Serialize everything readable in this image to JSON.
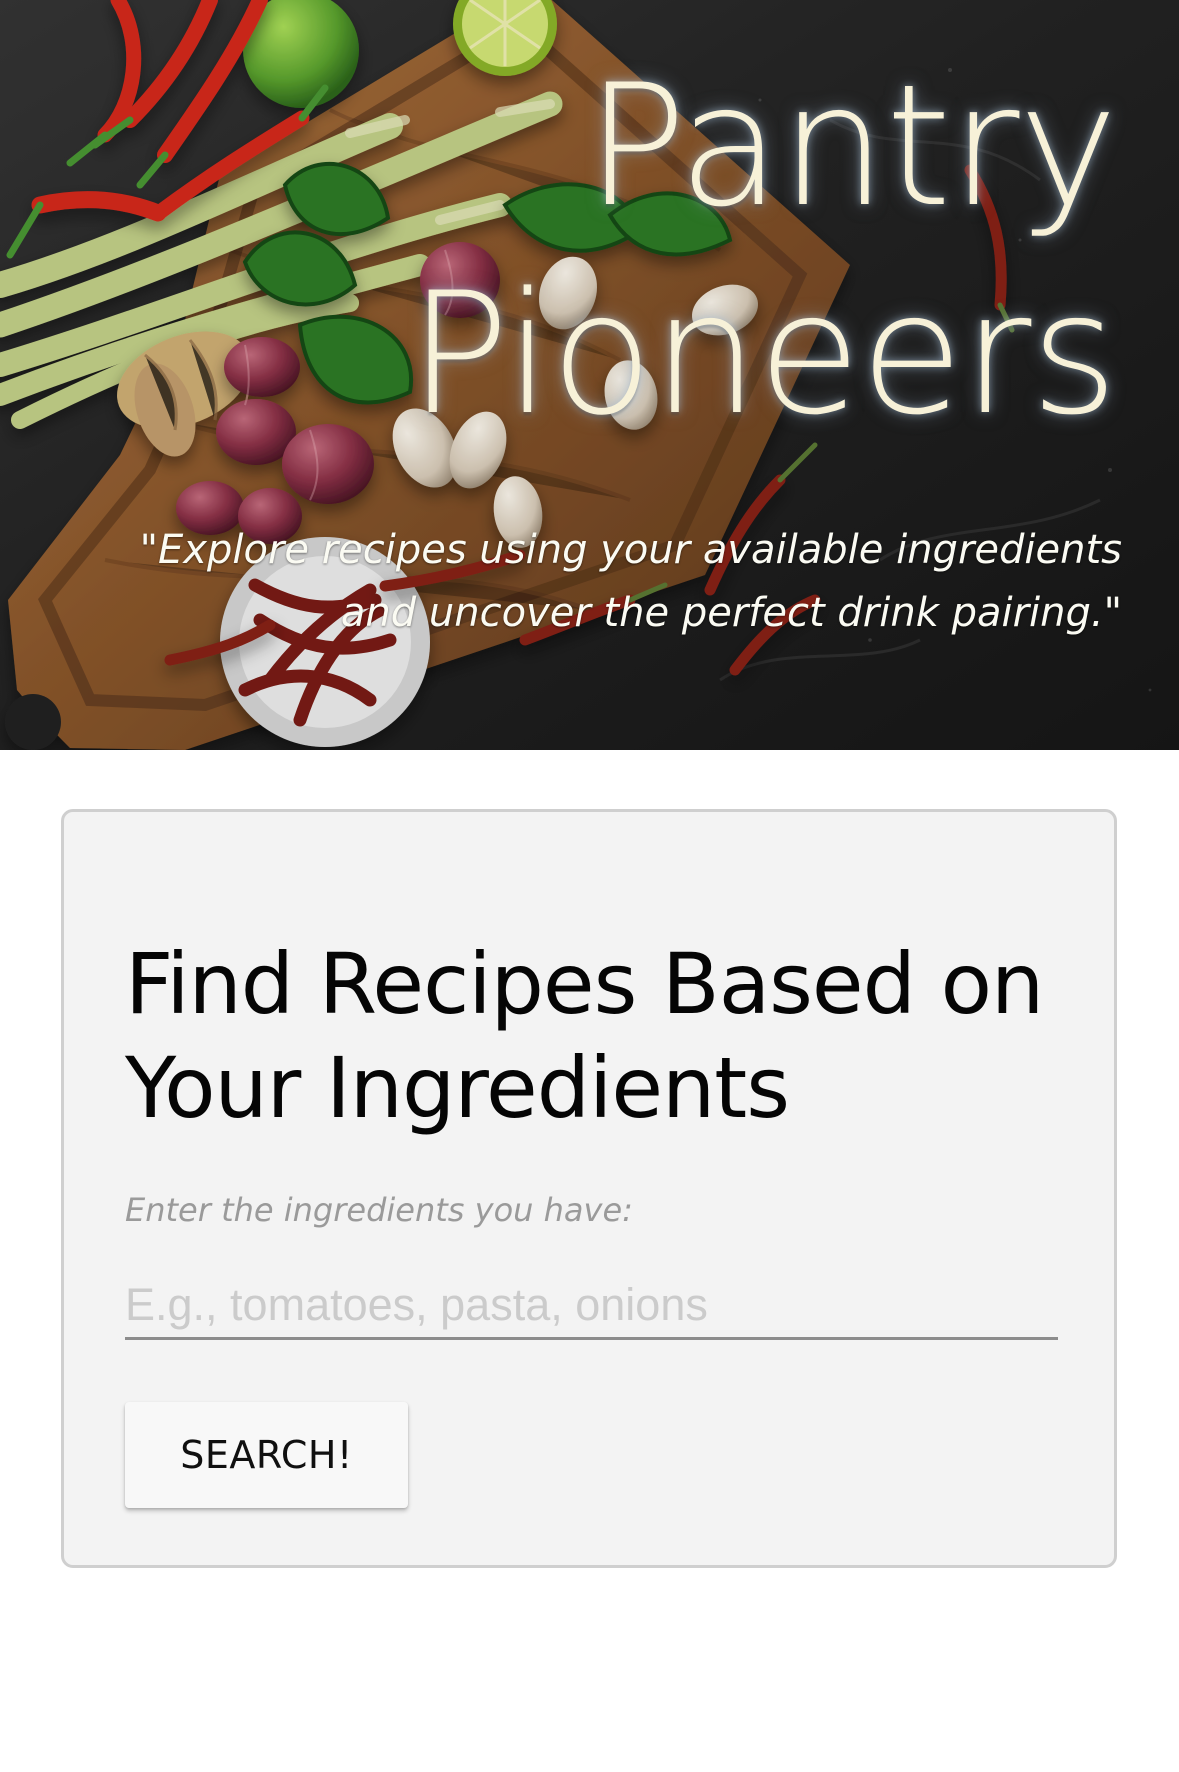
{
  "hero": {
    "title_line_1": "Pantry",
    "title_line_2": "Pioneers",
    "tagline": "\"Explore recipes using your available ingredients and uncover the perfect drink pairing.\""
  },
  "search": {
    "heading": "Find Recipes Based on Your Ingredients",
    "label": "Enter the ingredients you have:",
    "placeholder": "E.g., tomatoes, pasta, onions",
    "value": "",
    "button_label": "SEARCH!"
  },
  "colors": {
    "hero_title": "#f7f1d8",
    "card_background": "#f3f3f3",
    "card_border": "#cfcfcf",
    "input_border": "#8c8c8c"
  },
  "icons": {
    "hero_image": "ingredients-on-cutting-board-image"
  }
}
